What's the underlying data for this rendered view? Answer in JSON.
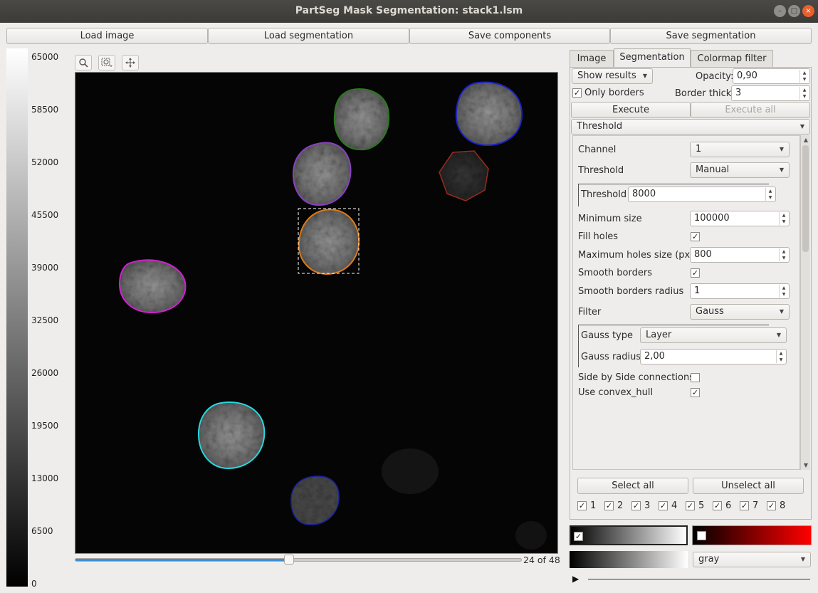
{
  "window": {
    "title": "PartSeg Mask Segmentation: stack1.lsm",
    "minimize_icon": "minimize-icon",
    "maximize_icon": "maximize-icon",
    "close_icon": "close-icon"
  },
  "toolbar": {
    "load_image": "Load image",
    "load_segmentation": "Load segmentation",
    "save_components": "Save components",
    "save_segmentation": "Save segmentation"
  },
  "colorbar": {
    "labels": [
      "65000",
      "58500",
      "52000",
      "45500",
      "39000",
      "32500",
      "26000",
      "19500",
      "13000",
      "6500",
      "0"
    ]
  },
  "view_tools": {
    "zoom_icon": "zoom-icon",
    "zoom_region_icon": "zoom-region-icon",
    "pan_icon": "move-icon"
  },
  "stack": {
    "frame_label": "24 of 48",
    "progress": 0.48
  },
  "tabs": [
    "Image",
    "Segmentation",
    "Colormap filter"
  ],
  "active_tab": "Segmentation",
  "segmentation": {
    "show_results": "Show results",
    "opacity_label": "Opacity:",
    "opacity_value": "0,90",
    "only_borders_label": "Only borders",
    "only_borders_checked": true,
    "border_thick_label": "Border thick:",
    "border_thick_value": "3",
    "execute": "Execute",
    "execute_all": "Execute all",
    "algorithm": "Threshold"
  },
  "params": {
    "channel_label": "Channel",
    "channel_value": "1",
    "threshold_label": "Threshold",
    "threshold_mode": "Manual",
    "threshold_inner_label": "Threshold",
    "threshold_value": "8000",
    "min_size_label": "Minimum size",
    "min_size_value": "100000",
    "fill_holes_label": "Fill holes",
    "fill_holes_checked": true,
    "max_holes_label": "Maximum holes size (px)",
    "max_holes_value": "800",
    "smooth_borders_label": "Smooth borders",
    "smooth_borders_checked": true,
    "smooth_radius_label": "Smooth borders radius",
    "smooth_radius_value": "1",
    "filter_label": "Filter",
    "filter_value": "Gauss",
    "gauss_type_label": "Gauss type",
    "gauss_type_value": "Layer",
    "gauss_radius_label": "Gauss radius",
    "gauss_radius_value": "2,00",
    "side_by_side_label": "Side by Side connections",
    "side_by_side_checked": false,
    "convex_hull_label": "Use convex_hull",
    "convex_hull_checked": true
  },
  "components": {
    "select_all": "Select all",
    "unselect_all": "Unselect all",
    "items": [
      "1",
      "2",
      "3",
      "4",
      "5",
      "6",
      "7",
      "8"
    ]
  },
  "colormap": {
    "selected": "gray",
    "play_icon": "play-icon"
  },
  "nuclei": [
    {
      "color": "#2a7a1e"
    },
    {
      "color": "#1f22c8"
    },
    {
      "color": "#8a3fc3"
    },
    {
      "color": "#9a2a1e"
    },
    {
      "color": "#e07a10"
    },
    {
      "color": "#d020d0"
    },
    {
      "color": "#28d8e0"
    },
    {
      "color": "#1a20a0"
    }
  ]
}
